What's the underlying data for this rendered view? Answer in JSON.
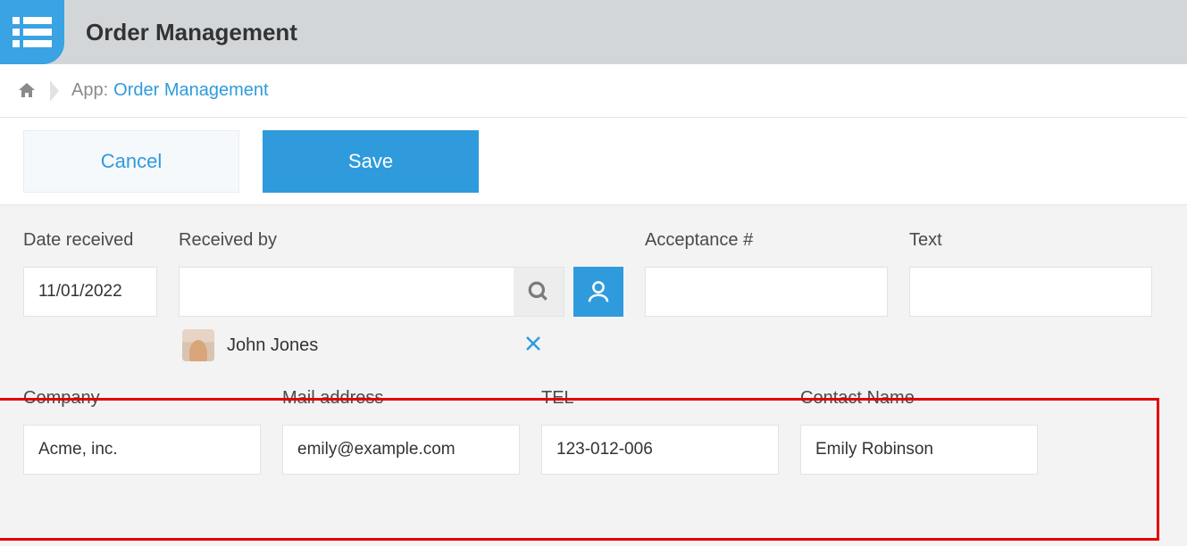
{
  "header": {
    "title": "Order Management"
  },
  "breadcrumb": {
    "label": "App:",
    "link": "Order Management"
  },
  "toolbar": {
    "cancel": "Cancel",
    "save": "Save"
  },
  "form": {
    "date_received_label": "Date received",
    "date_received_value": "11/01/2022",
    "received_by_label": "Received by",
    "received_by_value": "",
    "acceptance_label": "Acceptance #",
    "acceptance_value": "",
    "text_label": "Text",
    "text_value": "",
    "selected_user": "John Jones",
    "company_label": "Company",
    "company_value": "Acme, inc.",
    "mail_label": "Mail address",
    "mail_value": "emily@example.com",
    "tel_label": "TEL",
    "tel_value": "123-012-006",
    "contact_label": "Contact Name",
    "contact_value": "Emily Robinson"
  }
}
